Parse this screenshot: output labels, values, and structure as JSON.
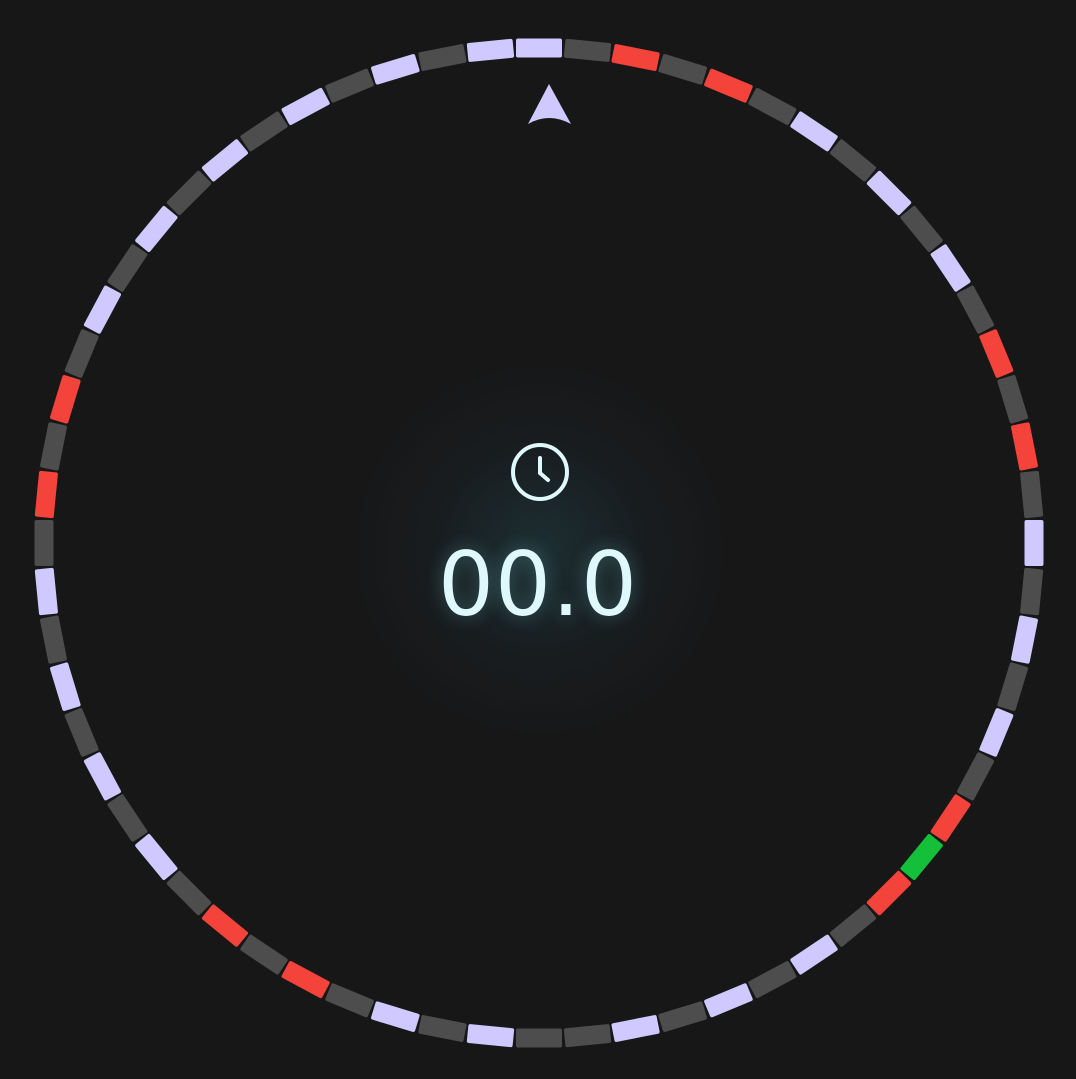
{
  "colors": {
    "background": "#171718",
    "lavender": "#cfc9ff",
    "red": "#f4433a",
    "gray": "#4d4d4d",
    "green": "#14bf3a",
    "timer_text": "#dff8fb"
  },
  "pointer": {
    "icon": "navigation-arrow-icon",
    "color": "#cfc9ff"
  },
  "timer": {
    "icon": "clock-icon",
    "value": "00.0"
  },
  "wheel": {
    "segment_count": 64,
    "segments": [
      "lavender",
      "gray",
      "red",
      "gray",
      "red",
      "gray",
      "lavender",
      "gray",
      "lavender",
      "gray",
      "lavender",
      "gray",
      "red",
      "gray",
      "red",
      "gray",
      "lavender",
      "gray",
      "lavender",
      "gray",
      "lavender",
      "gray",
      "red",
      "green",
      "red",
      "gray",
      "lavender",
      "gray",
      "lavender",
      "gray",
      "lavender",
      "gray",
      "gray",
      "lavender",
      "gray",
      "lavender",
      "gray",
      "red",
      "gray",
      "red",
      "gray",
      "lavender",
      "gray",
      "lavender",
      "gray",
      "lavender",
      "gray",
      "lavender",
      "gray",
      "red",
      "gray",
      "red",
      "gray",
      "lavender",
      "gray",
      "lavender",
      "gray",
      "lavender",
      "gray",
      "lavender",
      "gray",
      "lavender",
      "gray",
      "lavender"
    ]
  }
}
